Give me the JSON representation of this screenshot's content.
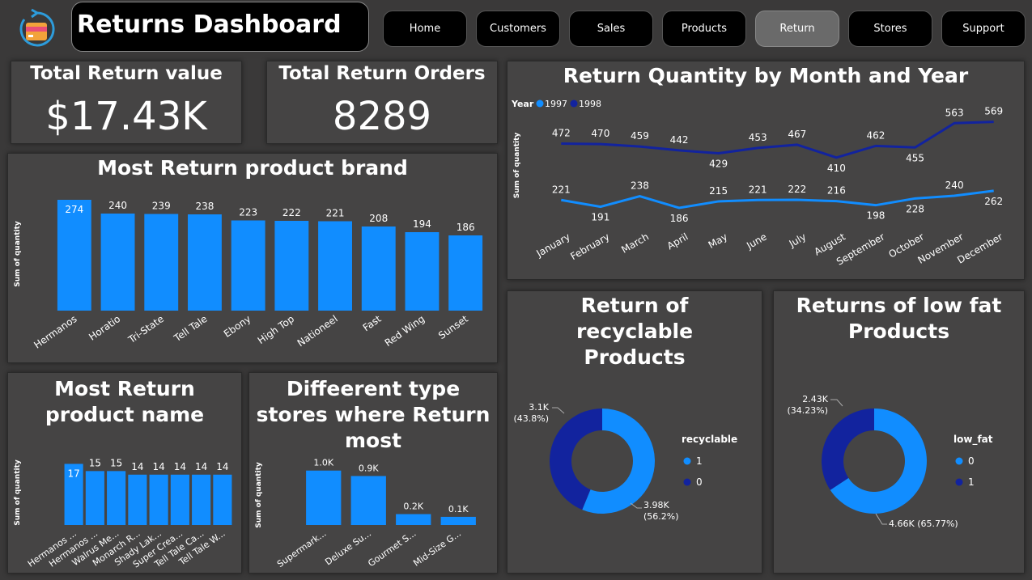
{
  "header": {
    "title": "Returns Dashboard"
  },
  "nav": [
    "Home",
    "Customers",
    "Sales",
    "Products",
    "Return",
    "Stores",
    "Support"
  ],
  "nav_active_index": 4,
  "kpis": {
    "total_return_value": {
      "label": "Total Return value",
      "value": "$17.43K"
    },
    "total_return_orders": {
      "label": "Total Return Orders",
      "value": "8289"
    }
  },
  "icons": {
    "logo": "returns-box-icon"
  },
  "colors": {
    "accent": "#118DFF",
    "dark_series": "#12239E",
    "panel": "#454444",
    "background": "#3a3939"
  },
  "chart_data": [
    {
      "id": "brand",
      "type": "bar",
      "title": "Most Return product brand",
      "ylabel": "Sum of quantity",
      "categories": [
        "Hermanos",
        "Horatio",
        "Tri-State",
        "Tell Tale",
        "Ebony",
        "High Top",
        "Nationeel",
        "Fast",
        "Red Wing",
        "Sunset"
      ],
      "values": [
        274,
        240,
        239,
        238,
        223,
        222,
        221,
        208,
        194,
        186
      ],
      "ylim": [
        0,
        280
      ]
    },
    {
      "id": "product",
      "type": "bar",
      "title": "Most Return product name",
      "ylabel": "Sum of quantity",
      "categories": [
        "Hermanos ...",
        "Hermanos ...",
        "Walrus Me...",
        "Monarch R...",
        "Shady Lak...",
        "Super Crea...",
        "Tell Tale Ca...",
        "Tell Tale W..."
      ],
      "values": [
        17,
        15,
        15,
        14,
        14,
        14,
        14,
        14
      ],
      "ylim": [
        0,
        18
      ]
    },
    {
      "id": "stores",
      "type": "bar",
      "title": "Diffeerent type stores where Return most",
      "ylabel": "Sum of quantity",
      "categories": [
        "Supermark...",
        "Deluxe Su...",
        "Gourmet S...",
        "Mid-Size G..."
      ],
      "values": [
        1000,
        900,
        200,
        150
      ],
      "data_labels": [
        "1.0K",
        "0.9K",
        "0.2K",
        "0.1K"
      ],
      "ylim": [
        0,
        1100
      ]
    },
    {
      "id": "monthly",
      "type": "line",
      "title": "Return Quantity by Month and Year",
      "ylabel": "Sum of quantity",
      "legend_title": "Year",
      "categories": [
        "January",
        "February",
        "March",
        "April",
        "May",
        "June",
        "July",
        "August",
        "September",
        "October",
        "November",
        "December"
      ],
      "series": [
        {
          "name": "1997",
          "color": "#118DFF",
          "values": [
            221,
            191,
            238,
            186,
            215,
            221,
            222,
            216,
            198,
            228,
            240,
            262
          ]
        },
        {
          "name": "1998",
          "color": "#12239E",
          "values": [
            472,
            470,
            459,
            442,
            429,
            453,
            467,
            410,
            462,
            455,
            563,
            569
          ]
        }
      ],
      "ylim": [
        150,
        600
      ]
    },
    {
      "id": "recyclable",
      "type": "pie",
      "title": "Return of recyclable Products",
      "legend_title": "recyclable",
      "slices": [
        {
          "label": "1",
          "value": 3980,
          "text": "3.98K",
          "pct": "(56.2%)",
          "color": "#118DFF"
        },
        {
          "label": "0",
          "value": 3100,
          "text": "3.1K",
          "pct": "(43.8%)",
          "color": "#12239E"
        }
      ]
    },
    {
      "id": "lowfat",
      "type": "pie",
      "title": "Returns of low fat Products",
      "legend_title": "low_fat",
      "slices": [
        {
          "label": "0",
          "value": 4660,
          "text": "4.66K (65.77%)",
          "color": "#118DFF"
        },
        {
          "label": "1",
          "value": 2430,
          "text": "2.43K",
          "pct": "(34.23%)",
          "color": "#12239E"
        }
      ]
    }
  ]
}
